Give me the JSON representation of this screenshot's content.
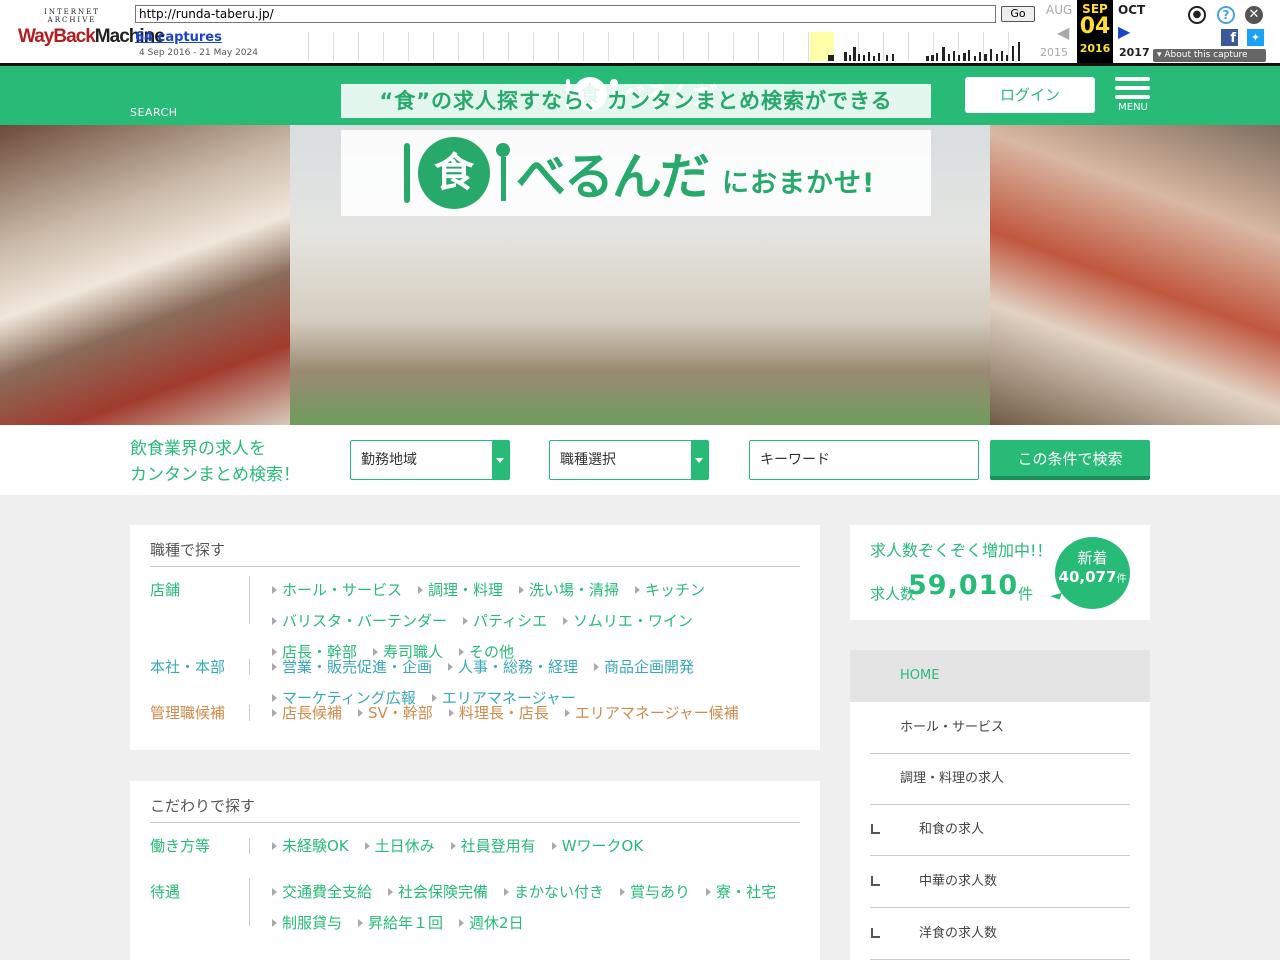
{
  "wayback": {
    "logo_top": "INTERNET ARCHIVE",
    "logo_way": "WayBack",
    "logo_machine": "Machine",
    "url": "http://runda-taberu.jp/",
    "go_label": "Go",
    "captures": "64 captures",
    "range": "4 Sep 2016 - 21 May 2024",
    "prev_month": "AUG",
    "cur_month": "SEP",
    "cur_day": "04",
    "cur_year": "2016",
    "next_month": "OCT",
    "prev_year": "2015",
    "next_year": "2017",
    "about": "About this capture",
    "icons": [
      "user-icon",
      "help-icon",
      "close-icon",
      "facebook-icon",
      "twitter-icon"
    ]
  },
  "header": {
    "search_label": "SEARCH",
    "logo_char": "食",
    "logo_text": "べるんだ",
    "login_label": "ログイン",
    "menu_label": "MENU",
    "brand_color": "#27bb77"
  },
  "hero": {
    "tagline": "“食”の求人探すなら、カンタンまとめ検索ができる",
    "logo_char": "食",
    "logo_text": "べるんだ",
    "logo_suffix": "におまかせ!"
  },
  "search": {
    "title_line1": "飲食業界の求人を",
    "title_line2": "カンタンまとめ検索！",
    "area_label": "勤務地域",
    "job_label": "職種選択",
    "keyword_placeholder": "キーワード",
    "submit_label": "この条件で検索"
  },
  "job_types": {
    "heading": "職種で探す",
    "rows": [
      {
        "label": "店舗",
        "links": [
          "ホール・サービス",
          "調理・料理",
          "洗い場・清掃",
          "キッチン",
          "バリスタ・バーテンダー",
          "パティシエ",
          "ソムリエ・ワイン",
          "店長・幹部",
          "寿司職人",
          "その他"
        ]
      },
      {
        "label": "本社・本部",
        "links": [
          "営業・販売促進・企画",
          "人事・総務・経理",
          "商品企画開発",
          "マーケティング広報",
          "エリアマネージャー"
        ]
      },
      {
        "label": "管理職候補",
        "links": [
          "店長候補",
          "SV・幹部",
          "料理長・店長",
          "エリアマネージャー候補"
        ]
      }
    ]
  },
  "conditions": {
    "heading": "こだわりで探す",
    "rows": [
      {
        "label": "働き方等",
        "links": [
          "未経験OK",
          "土日休み",
          "社員登用有",
          "WワークOK"
        ]
      },
      {
        "label": "待遇",
        "links": [
          "交通費全支給",
          "社会保険完備",
          "まかない付き",
          "賞与あり",
          "寮・社宅",
          "制服貸与",
          "昇給年１回",
          "週休2日"
        ]
      }
    ]
  },
  "counter": {
    "title": "求人数ぞくぞく増加中!！",
    "prefix": "求人数",
    "total": "59,010",
    "suffix": "件",
    "badge_label": "新着",
    "badge_count": "40,077",
    "badge_unit": "件"
  },
  "side_nav": {
    "home": "HOME",
    "items": [
      {
        "label": "ホール・サービス",
        "level": 1
      },
      {
        "label": "調理・料理の求人",
        "level": 1
      },
      {
        "label": "和食の求人",
        "level": 2
      },
      {
        "label": "中華の求人数",
        "level": 2
      },
      {
        "label": "洋食の求人数",
        "level": 2
      }
    ]
  }
}
